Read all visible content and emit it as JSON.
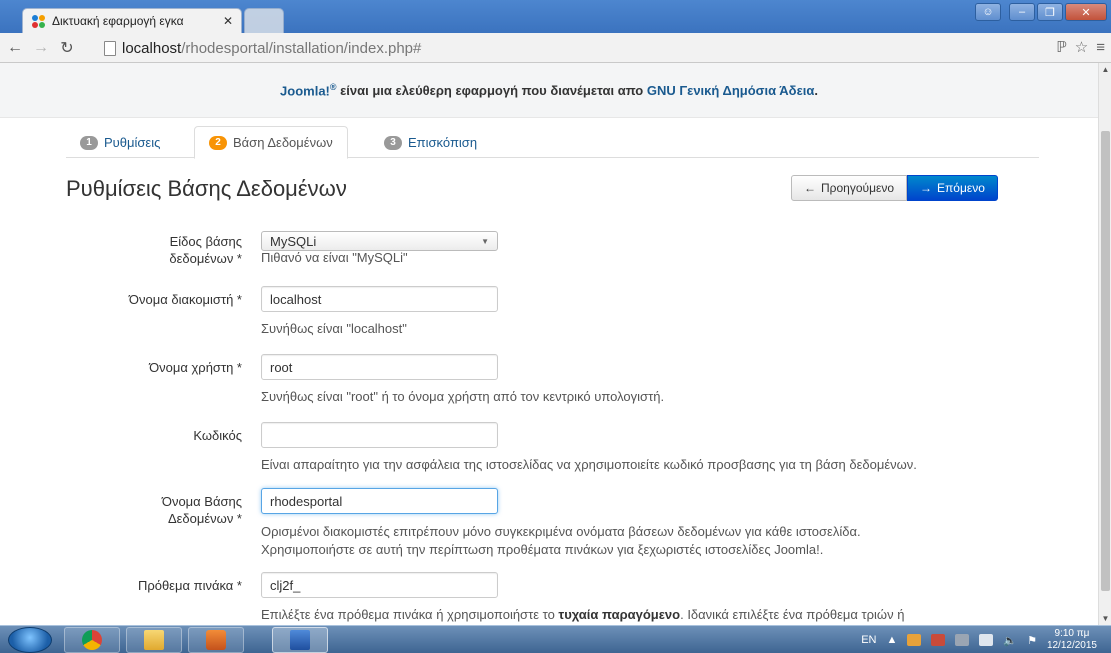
{
  "browser": {
    "tab_title": "Δικτυακή εφαρμογή εγκα",
    "tab_close": "✕",
    "url_host": "localhost",
    "url_path": "/rhodesportal/installation/index.php#"
  },
  "header": {
    "brand": "Joomla!",
    "registered": "®",
    "text": " είναι μια ελεύθερη εφαρμογή που διανέμεται απο ",
    "license": "GNU Γενική Δημόσια Άδεια",
    "dot": "."
  },
  "wizard": {
    "tabs": [
      {
        "num": "1",
        "label": "Ρυθμίσεις"
      },
      {
        "num": "2",
        "label": "Βάση Δεδομένων"
      },
      {
        "num": "3",
        "label": "Επισκόπιση"
      }
    ]
  },
  "page": {
    "title": "Ρυθμίσεις Βάσης Δεδομένων",
    "prev_label": "Προηγούμενο",
    "next_label": "Επόμενο",
    "prev_arrow": "←",
    "next_arrow": "→"
  },
  "form": {
    "db_type": {
      "label_line1": "Είδος βάσης",
      "label_line2": "δεδομένων *",
      "value": "MySQLi",
      "help": "Πιθανό να είναι \"MySQLi\""
    },
    "host": {
      "label": "Όνομα διακομιστή *",
      "value": "localhost",
      "help": "Συνήθως είναι \"localhost\""
    },
    "user": {
      "label": "Όνομα χρήστη *",
      "value": "root",
      "help": "Συνήθως είναι \"root\" ή το όνομα χρήστη από τον κεντρικό υπολογιστή."
    },
    "password": {
      "label": "Κωδικός",
      "value": "",
      "help": "Είναι απαραίτητο για την ασφάλεια της ιστοσελίδας να χρησιμοποιείτε κωδικό προσβασης για τη βάση δεδομένων."
    },
    "db_name": {
      "label_line1": "Όνομα Βάσης",
      "label_line2": "Δεδομένων *",
      "value": "rhodesportal",
      "help_line1": "Ορισμένοι διακομιστές επιτρέπουν μόνο συγκεκριμένα ονόματα βάσεων δεδομένων για κάθε ιστοσελίδα.",
      "help_line2": "Χρησιμοποιήστε σε αυτή την περίπτωση προθέματα πινάκων για ξεχωριστές ιστοσελίδες Joomla!."
    },
    "prefix": {
      "label": "Πρόθεμα πινάκα *",
      "value": "clj2f_",
      "help_start": "Επιλέξτε ένα πρόθεμα πινάκα ή χρησιμοποιήστε το ",
      "help_bold": "τυχαία παραγόμενο",
      "help_end": ". Ιδανικά επιλέξτε ένα πρόθεμα τριών ή"
    }
  },
  "taskbar": {
    "lang": "EN",
    "time": "9:10 πμ",
    "date": "12/12/2015"
  },
  "colors": {
    "link": "#1a5a8f",
    "active_step": "#f89406",
    "primary_button": "#0055cc"
  }
}
